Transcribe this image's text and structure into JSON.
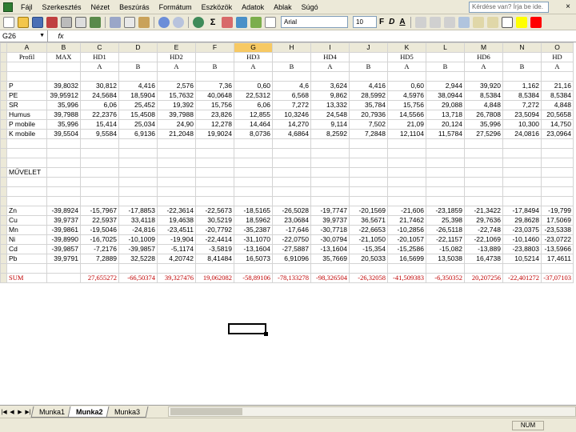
{
  "menubar": {
    "items": [
      "Fájl",
      "Szerkesztés",
      "Nézet",
      "Beszúrás",
      "Formátum",
      "Eszközök",
      "Adatok",
      "Ablak",
      "Súgó"
    ],
    "help_placeholder": "Kérdése van? Írja be ide."
  },
  "toolbar": {
    "font": "Arial",
    "size": "10",
    "bold": "F",
    "italic": "D",
    "underline": "A"
  },
  "formula": {
    "cell_ref": "G26",
    "fx": "fx",
    "content": ""
  },
  "columns": [
    "A",
    "B",
    "C",
    "D",
    "E",
    "F",
    "G",
    "H",
    "I",
    "J",
    "K",
    "L",
    "M",
    "N",
    "O"
  ],
  "active_column": "G",
  "rows": [
    [
      "Profil",
      "MAX",
      "HD1",
      "",
      "HD2",
      "",
      "HD3",
      "",
      "HD4",
      "",
      "HD5",
      "",
      "HD6",
      "",
      "HD"
    ],
    [
      "",
      "",
      "A",
      "B",
      "A",
      "B",
      "A",
      "B",
      "A",
      "B",
      "A",
      "B",
      "A",
      "B",
      "A"
    ],
    [
      "",
      "",
      "",
      "",
      "",
      "",
      "",
      "",
      "",
      "",
      "",
      "",
      "",
      "",
      ""
    ],
    [
      "P",
      "39,8032",
      "30,812",
      "4,416",
      "2,576",
      "7,36",
      "0,60",
      "4,6",
      "3,624",
      "4,416",
      "0,60",
      "2,944",
      "39,920",
      "1,162",
      "21,16"
    ],
    [
      "PE",
      "39,95912",
      "24,5684",
      "18,5904",
      "15,7632",
      "40,0648",
      "22,5312",
      "6,568",
      "9,862",
      "28,5992",
      "4,5976",
      "38,0944",
      "8,5384",
      "8,5384",
      "8,5384"
    ],
    [
      "SR",
      "35,996",
      "6,06",
      "25,452",
      "19,392",
      "15,756",
      "6,06",
      "7,272",
      "13,332",
      "35,784",
      "15,756",
      "29,088",
      "4,848",
      "7,272",
      "4,848"
    ],
    [
      "Humus",
      "39,7988",
      "22,2376",
      "15,4508",
      "39,7988",
      "23,826",
      "12,855",
      "10,3246",
      "24,548",
      "20,7936",
      "14,5566",
      "13,718",
      "26,7808",
      "23,5094",
      "20,5658"
    ],
    [
      "P mobile",
      "35,996",
      "15,414",
      "25,034",
      "24,90",
      "12,278",
      "14,464",
      "14,270",
      "9,114",
      "7,502",
      "21,09",
      "20,124",
      "35,996",
      "10,300",
      "14,750"
    ],
    [
      "K mobile",
      "39,5504",
      "9,5584",
      "6,9136",
      "21,2048",
      "19,9024",
      "8,0736",
      "4,6864",
      "8,2592",
      "7,2848",
      "12,1104",
      "11,5784",
      "27,5296",
      "24,0816",
      "23,0964"
    ],
    [
      "",
      "",
      "",
      "",
      "",
      "",
      "",
      "",
      "",
      "",
      "",
      "",
      "",
      "",
      ""
    ],
    [
      "",
      "",
      "",
      "",
      "",
      "",
      "",
      "",
      "",
      "",
      "",
      "",
      "",
      "",
      ""
    ],
    [
      "",
      "",
      "",
      "",
      "",
      "",
      "",
      "",
      "",
      "",
      "",
      "",
      "",
      "",
      ""
    ],
    [
      "MŰVELET",
      "",
      "",
      "",
      "",
      "",
      "",
      "",
      "",
      "",
      "",
      "",
      "",
      "",
      ""
    ],
    [
      "",
      "",
      "",
      "",
      "",
      "",
      "",
      "",
      "",
      "",
      "",
      "",
      "",
      "",
      ""
    ],
    [
      "",
      "",
      "",
      "",
      "",
      "",
      "",
      "",
      "",
      "",
      "",
      "",
      "",
      "",
      ""
    ],
    [
      "",
      "",
      "",
      "",
      "",
      "",
      "",
      "",
      "",
      "",
      "",
      "",
      "",
      "",
      ""
    ],
    [
      "Zn",
      "-39,8924",
      "-15,7967",
      "-17,8853",
      "-22,3614",
      "-22,5673",
      "-18,5165",
      "-26,5028",
      "-19,7747",
      "-20,1569",
      "-21,606",
      "-23,1859",
      "-21,3422",
      "-17,8494",
      "-19,799"
    ],
    [
      "Cu",
      "39,9737",
      "22,5937",
      "33,4118",
      "19,4638",
      "30,5219",
      "18,5962",
      "23,0684",
      "39,9737",
      "36,5671",
      "21,7462",
      "25,398",
      "29,7636",
      "29,8628",
      "17,5069"
    ],
    [
      "Mn",
      "-39,9861",
      "-19,5046",
      "-24,816",
      "-23,4511",
      "-20,7792",
      "-35,2387",
      "-17,646",
      "-30,7718",
      "-22,6653",
      "-10,2856",
      "-26,5118",
      "-22,748",
      "-23,0375",
      "-23,5338"
    ],
    [
      "Ni",
      "-39,8990",
      "-16,7025",
      "-10,1009",
      "-19,904",
      "-22,4414",
      "-31,1070",
      "-22,0750",
      "-30,0794",
      "-21,1050",
      "-20,1057",
      "-22,1157",
      "-22,1069",
      "-10,1460",
      "-23,0722"
    ],
    [
      "Cd",
      "-39,9857",
      "-7,2176",
      "-39,9857",
      "-5,1174",
      "-3,5819",
      "-13,1604",
      "-27,5887",
      "-13,1604",
      "-15,354",
      "-15,2586",
      "-15,082",
      "-13,889",
      "-23,8803",
      "-13,5966"
    ],
    [
      "Pb",
      "39,9791",
      "7,2889",
      "32,5228",
      "4,20742",
      "8,41484",
      "16,5073",
      "6,91096",
      "35,7669",
      "20,5033",
      "16,5699",
      "13,5038",
      "16,4738",
      "10,5214",
      "17,4611"
    ],
    [
      "",
      "",
      "",
      "",
      "",
      "",
      "",
      "",
      "",
      "",
      "",
      "",
      "",
      "",
      ""
    ],
    [
      "SUM",
      "",
      "27,655272",
      "-66,50374",
      "39,327476",
      "19,062082",
      "-58,89106",
      "-78,133278",
      "-98,326504",
      "-26,32058",
      "-41,509383",
      "-6,350352",
      "20,207256",
      "-22,401272",
      "-37,07103"
    ]
  ],
  "sheets": {
    "tabs": [
      "Munka1",
      "Munka2",
      "Munka3"
    ],
    "active": "Munka2"
  },
  "status": {
    "num": "NUM"
  }
}
